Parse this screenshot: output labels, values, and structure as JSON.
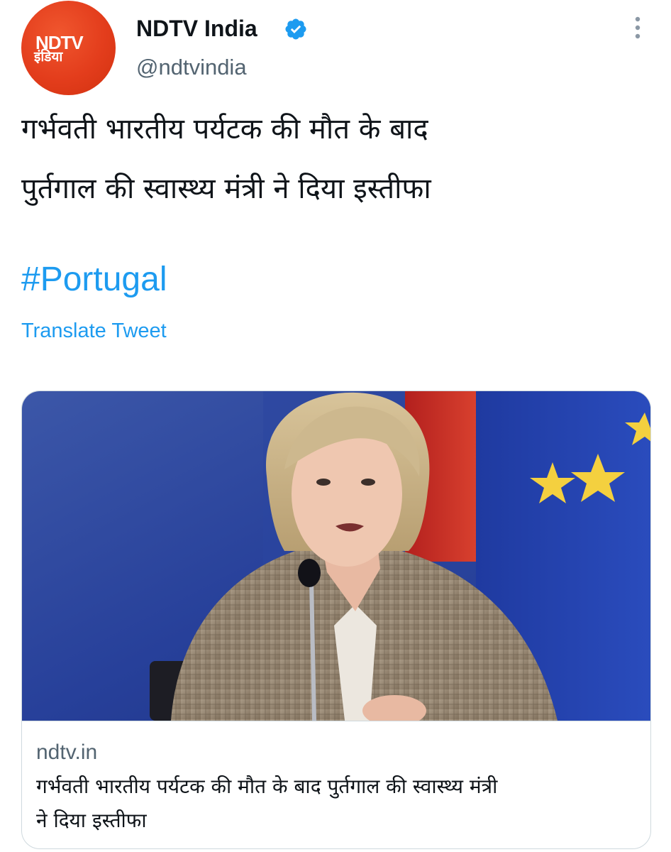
{
  "tweet": {
    "author": {
      "display_name": "NDTV India",
      "handle": "@ndtvindia",
      "verified": true,
      "avatar_logo_text_top": "NDTV",
      "avatar_logo_text_bottom": "इंडिया",
      "avatar_color": "#e33d1c"
    },
    "more_menu_icon": "more-vertical-icon",
    "text_lines": [
      "गर्भवती भारतीय पर्यटक की मौत के बाद",
      "पुर्तगाल की स्वास्थ्य मंत्री ने दिया इस्तीफा"
    ],
    "hashtag": "#Portugal",
    "translate_label": "Translate Tweet",
    "link_color": "#1d9bf0",
    "card": {
      "domain": "ndtv.in",
      "title_lines": [
        "गर्भवती भारतीय पर्यटक की मौत के बाद पुर्तगाल की स्वास्थ्य मंत्री",
        "ने दिया इस्तीफा"
      ]
    }
  }
}
